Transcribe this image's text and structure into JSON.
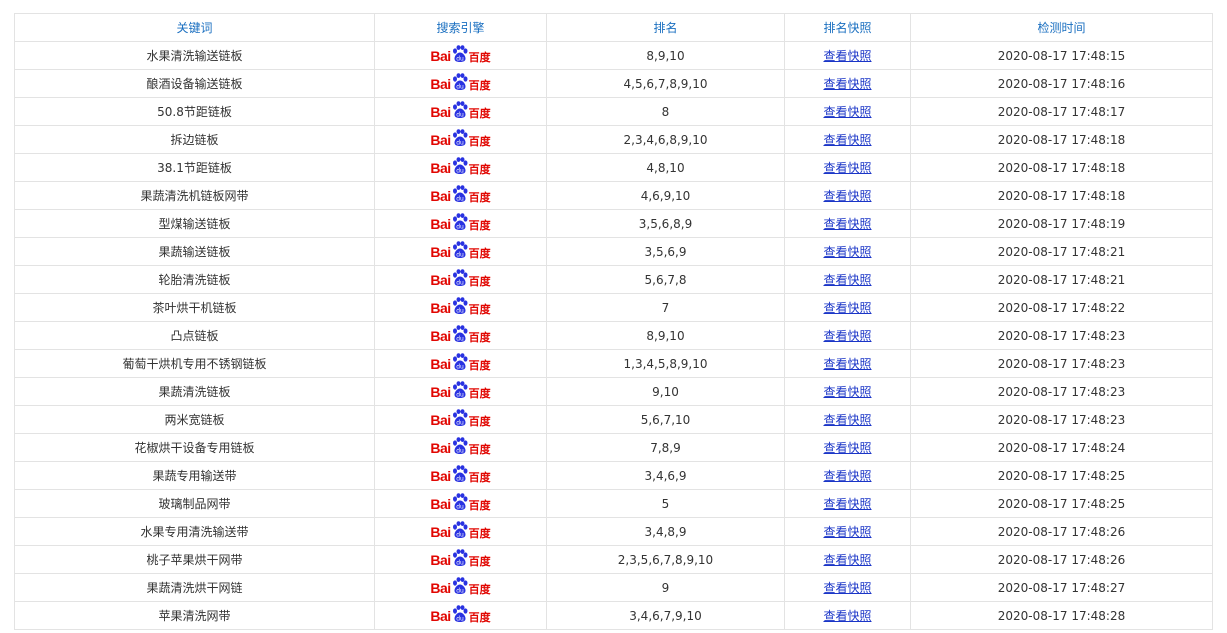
{
  "table": {
    "headers": [
      "关键词",
      "搜索引擎",
      "排名",
      "排名快照",
      "检测时间"
    ],
    "engine_logo_text": "Bai",
    "engine_logo_cn": "百度",
    "rows": [
      {
        "keyword": "水果清洗输送链板",
        "rank": "8,9,10",
        "snapshot": "查看快照",
        "time": "2020-08-17 17:48:15"
      },
      {
        "keyword": "酿酒设备输送链板",
        "rank": "4,5,6,7,8,9,10",
        "snapshot": "查看快照",
        "time": "2020-08-17 17:48:16"
      },
      {
        "keyword": "50.8节距链板",
        "rank": "8",
        "snapshot": "查看快照",
        "time": "2020-08-17 17:48:17"
      },
      {
        "keyword": "拆边链板",
        "rank": "2,3,4,6,8,9,10",
        "snapshot": "查看快照",
        "time": "2020-08-17 17:48:18"
      },
      {
        "keyword": "38.1节距链板",
        "rank": "4,8,10",
        "snapshot": "查看快照",
        "time": "2020-08-17 17:48:18"
      },
      {
        "keyword": "果蔬清洗机链板网带",
        "rank": "4,6,9,10",
        "snapshot": "查看快照",
        "time": "2020-08-17 17:48:18"
      },
      {
        "keyword": "型煤输送链板",
        "rank": "3,5,6,8,9",
        "snapshot": "查看快照",
        "time": "2020-08-17 17:48:19"
      },
      {
        "keyword": "果蔬输送链板",
        "rank": "3,5,6,9",
        "snapshot": "查看快照",
        "time": "2020-08-17 17:48:21"
      },
      {
        "keyword": "轮胎清洗链板",
        "rank": "5,6,7,8",
        "snapshot": "查看快照",
        "time": "2020-08-17 17:48:21"
      },
      {
        "keyword": "茶叶烘干机链板",
        "rank": "7",
        "snapshot": "查看快照",
        "time": "2020-08-17 17:48:22"
      },
      {
        "keyword": "凸点链板",
        "rank": "8,9,10",
        "snapshot": "查看快照",
        "time": "2020-08-17 17:48:23"
      },
      {
        "keyword": "葡萄干烘机专用不锈钢链板",
        "rank": "1,3,4,5,8,9,10",
        "snapshot": "查看快照",
        "time": "2020-08-17 17:48:23"
      },
      {
        "keyword": "果蔬清洗链板",
        "rank": "9,10",
        "snapshot": "查看快照",
        "time": "2020-08-17 17:48:23"
      },
      {
        "keyword": "两米宽链板",
        "rank": "5,6,7,10",
        "snapshot": "查看快照",
        "time": "2020-08-17 17:48:23"
      },
      {
        "keyword": "花椒烘干设备专用链板",
        "rank": "7,8,9",
        "snapshot": "查看快照",
        "time": "2020-08-17 17:48:24"
      },
      {
        "keyword": "果蔬专用输送带",
        "rank": "3,4,6,9",
        "snapshot": "查看快照",
        "time": "2020-08-17 17:48:25"
      },
      {
        "keyword": "玻璃制品网带",
        "rank": "5",
        "snapshot": "查看快照",
        "time": "2020-08-17 17:48:25"
      },
      {
        "keyword": "水果专用清洗输送带",
        "rank": "3,4,8,9",
        "snapshot": "查看快照",
        "time": "2020-08-17 17:48:26"
      },
      {
        "keyword": "桃子苹果烘干网带",
        "rank": "2,3,5,6,7,8,9,10",
        "snapshot": "查看快照",
        "time": "2020-08-17 17:48:26"
      },
      {
        "keyword": "果蔬清洗烘干网链",
        "rank": "9",
        "snapshot": "查看快照",
        "time": "2020-08-17 17:48:27"
      },
      {
        "keyword": "苹果清洗网带",
        "rank": "3,4,6,7,9,10",
        "snapshot": "查看快照",
        "time": "2020-08-17 17:48:28"
      }
    ]
  }
}
